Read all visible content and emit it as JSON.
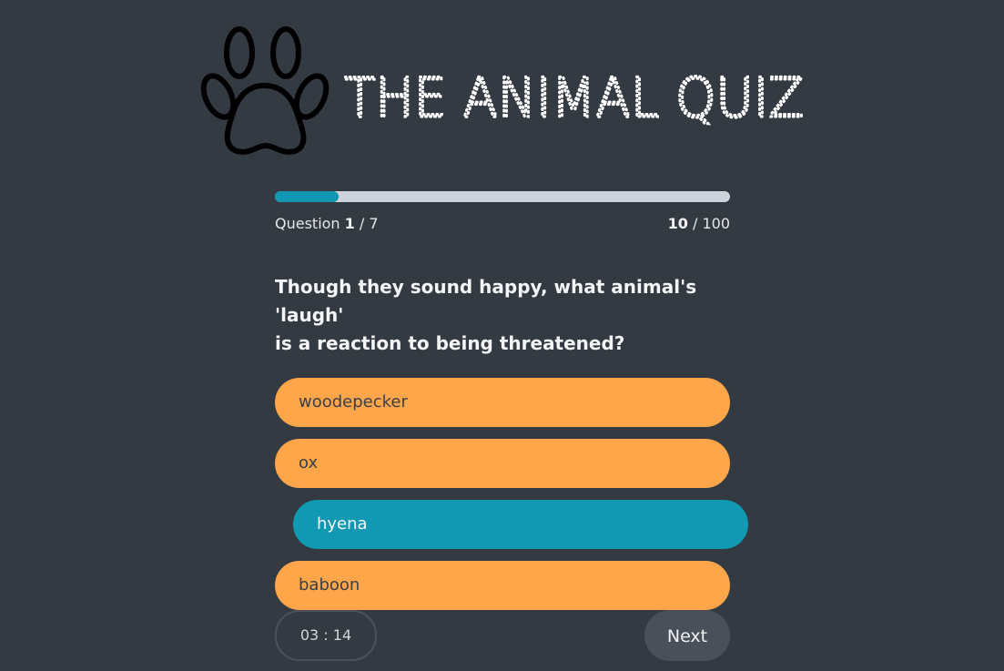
{
  "app": {
    "title": "THE ANIMAL QUIZ",
    "logo_icon": "paw-icon",
    "colors": {
      "background": "#343a42",
      "accent": "#1197b1",
      "answer": "#ffa64b",
      "track": "#ced3db"
    }
  },
  "progress": {
    "fraction": 0.14,
    "question_label": "Question",
    "current_question": "1",
    "separator": " / ",
    "total_questions": "7",
    "score": "10",
    "max_score": "100"
  },
  "question": {
    "text": "Though they sound happy, what animal's 'laugh'\nis a reaction to being threatened?"
  },
  "answers": [
    {
      "label": "woodepecker",
      "selected": false
    },
    {
      "label": "ox",
      "selected": false
    },
    {
      "label": "hyena",
      "selected": true
    },
    {
      "label": "baboon",
      "selected": false
    }
  ],
  "footer": {
    "timer": "03 : 14",
    "next_label": "Next"
  }
}
